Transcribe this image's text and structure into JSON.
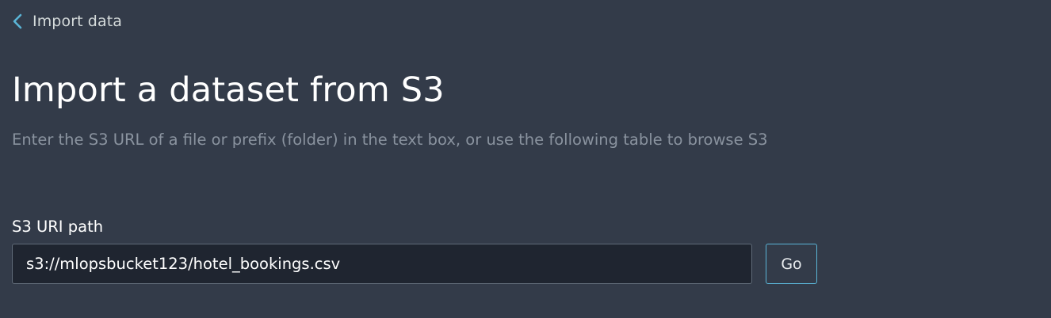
{
  "header": {
    "back_label": "Import data",
    "back_icon": "chevron-left-icon"
  },
  "main": {
    "title": "Import a dataset from S3",
    "subtitle": "Enter the S3 URL of a file or prefix (folder) in the text box, or use the following table to browse S3",
    "s3_field": {
      "label": "S3 URI path",
      "value": "s3://mlopsbucket123/hotel_bookings.csv",
      "placeholder": ""
    },
    "go_label": "Go"
  },
  "colors": {
    "background": "#333b49",
    "accent": "#5ab4d6",
    "input_background": "#1f2530",
    "muted_text": "#8a939f"
  }
}
